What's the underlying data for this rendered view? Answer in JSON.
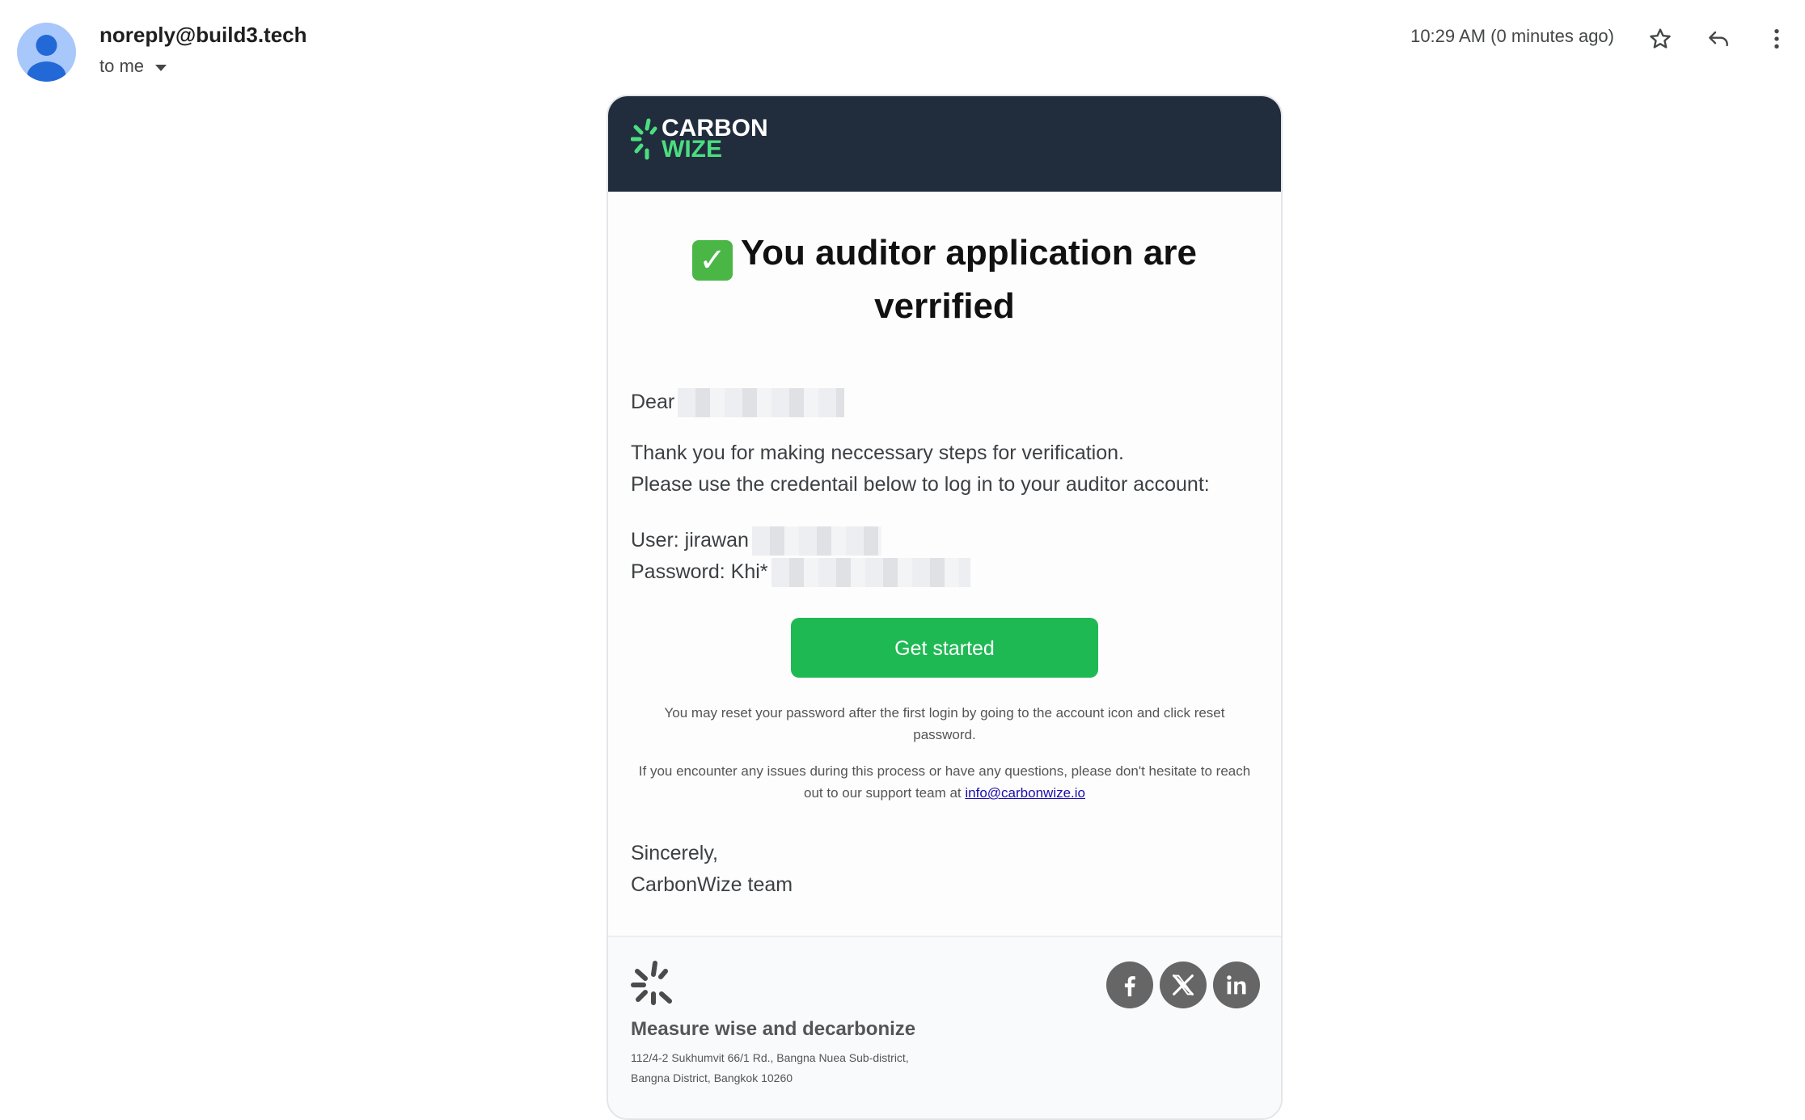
{
  "header": {
    "sender": "noreply@build3.tech",
    "recipient_label": "to me",
    "timestamp": "10:29 AM (0 minutes ago)",
    "icons": [
      "avatar-icon",
      "star-icon",
      "reply-icon",
      "more-vert-icon"
    ]
  },
  "email": {
    "brand": {
      "line1": "CARBON",
      "line2": "WIZE",
      "accent": "#4ade80",
      "banner_bg": "#212d3c"
    },
    "title_check": "✓",
    "title": "You auditor application are verrified",
    "greeting": "Dear",
    "thanks_line1": "Thank you for making neccessary steps for verification.",
    "thanks_line2": "Please use the credentail below to log in to your auditor account:",
    "user_label": "User: jirawan",
    "password_label": "Password: Khi*",
    "cta": "Get started",
    "cta_color": "#1fb954",
    "note_reset": "You may reset your password after the first login by going to the account icon and click reset password.",
    "note_support": "If you encounter any issues during this process or have any questions, please don't hesitate to reach out to our support team at",
    "support_email": "info@carbonwize.io",
    "sign_off": "Sincerely,",
    "sign_team": "CarbonWize team"
  },
  "footer": {
    "tagline": "Measure wise and decarbonize",
    "address_line1": "112/4-2 Sukhumvit 66/1 Rd., Bangna Nuea Sub-district,",
    "address_line2": "Bangna District, Bangkok 10260",
    "socials": [
      "facebook-icon",
      "x-twitter-icon",
      "linkedin-icon"
    ]
  }
}
